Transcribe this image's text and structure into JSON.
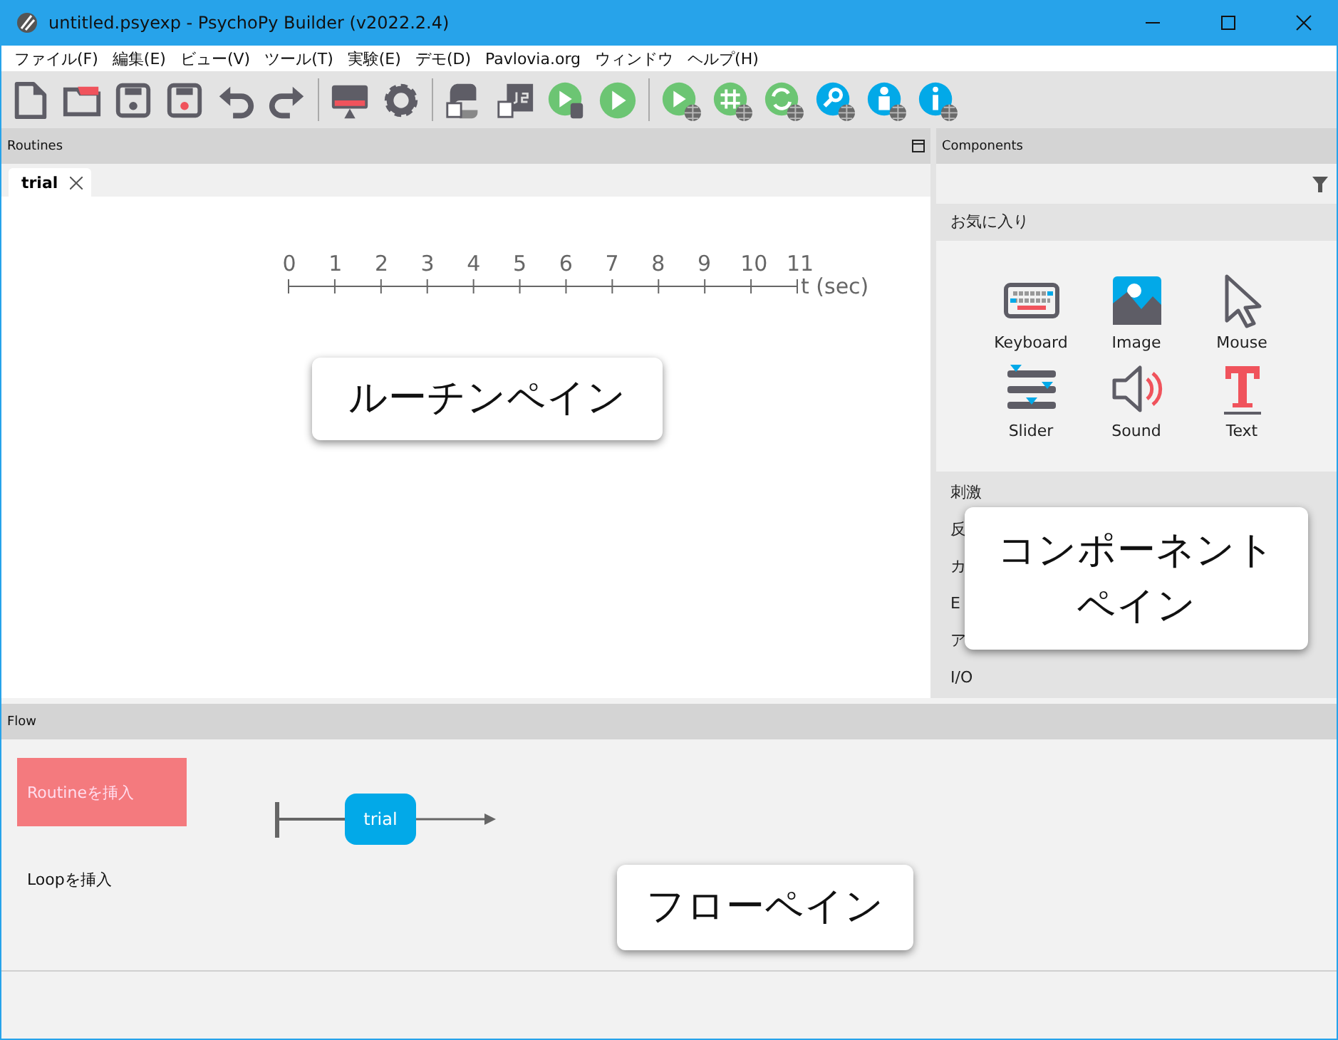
{
  "window": {
    "title": "untitled.psyexp - PsychoPy Builder (v2022.2.4)"
  },
  "menu": [
    "ファイル(F)",
    "編集(E)",
    "ビュー(V)",
    "ツール(T)",
    "実験(E)",
    "デモ(D)",
    "Pavlovia.org",
    "ウィンドウ",
    "ヘルプ(H)"
  ],
  "routines": {
    "title": "Routines",
    "tabs": [
      {
        "label": "trial",
        "selected": true
      }
    ],
    "timeline": {
      "ticks": [
        "0",
        "1",
        "2",
        "3",
        "4",
        "5",
        "6",
        "7",
        "8",
        "9",
        "10",
        "11"
      ],
      "unit": "t (sec)"
    }
  },
  "components": {
    "title": "Components",
    "favorites": "お気に入り",
    "items": [
      {
        "label": "Keyboard",
        "kind": "keyboard"
      },
      {
        "label": "Image",
        "kind": "image"
      },
      {
        "label": "Mouse",
        "kind": "mouse"
      },
      {
        "label": "Slider",
        "kind": "slider"
      },
      {
        "label": "Sound",
        "kind": "sound"
      },
      {
        "label": "Text",
        "kind": "text"
      }
    ],
    "categories": [
      "刺激",
      "反",
      "カ",
      "E",
      "ア",
      "I/O"
    ]
  },
  "flow": {
    "title": "Flow",
    "insert_routine": "Routineを挿入",
    "insert_loop": "Loopを挿入",
    "routines": [
      {
        "label": "trial"
      }
    ]
  },
  "callouts": {
    "routines": [
      "ルーチンペイン"
    ],
    "components": [
      "コンポーネント",
      "ペイン"
    ],
    "flow": [
      "フローペイン"
    ]
  }
}
